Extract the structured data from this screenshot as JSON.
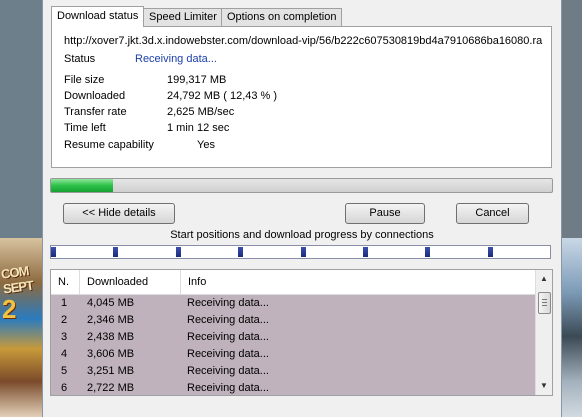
{
  "tabs": [
    "Download status",
    "Speed Limiter",
    "Options on completion"
  ],
  "download": {
    "url": "http://xover7.jkt.3d.x.indowebster.com/download-vip/56/b222c607530819bd4a7910686ba16080.ra",
    "status_label": "Status",
    "status_value": "Receiving data...",
    "file_size_label": "File size",
    "file_size_value": "199,317  MB",
    "downloaded_label": "Downloaded",
    "downloaded_value": "24,792  MB  ( 12,43 % )",
    "transfer_rate_label": "Transfer rate",
    "transfer_rate_value": "2,625  MB/sec",
    "time_left_label": "Time left",
    "time_left_value": "1 min 12 sec",
    "resume_label": "Resume capability",
    "resume_value": "Yes"
  },
  "progress": {
    "fraction": 0.1243,
    "color": "#2ec24a"
  },
  "buttons": {
    "hide_details": "<< Hide details",
    "pause": "Pause",
    "cancel": "Cancel"
  },
  "connections": {
    "title": "Start positions and download progress by connections",
    "start_fractions": [
      0.0,
      0.125,
      0.25,
      0.375,
      0.5,
      0.625,
      0.75,
      0.875
    ]
  },
  "list": {
    "headers": [
      "N.",
      "Downloaded",
      "Info"
    ],
    "rows": [
      {
        "n": "1",
        "downloaded": "4,045  MB",
        "info": "Receiving data..."
      },
      {
        "n": "2",
        "downloaded": "2,346  MB",
        "info": "Receiving data..."
      },
      {
        "n": "3",
        "downloaded": "2,438  MB",
        "info": "Receiving data..."
      },
      {
        "n": "4",
        "downloaded": "3,606  MB",
        "info": "Receiving data..."
      },
      {
        "n": "5",
        "downloaded": "3,251  MB",
        "info": "Receiving data..."
      },
      {
        "n": "6",
        "downloaded": "2,722  MB",
        "info": "Receiving data..."
      }
    ]
  },
  "background": {
    "left_art_text": "COM SEPT",
    "left_art_year": "2"
  }
}
